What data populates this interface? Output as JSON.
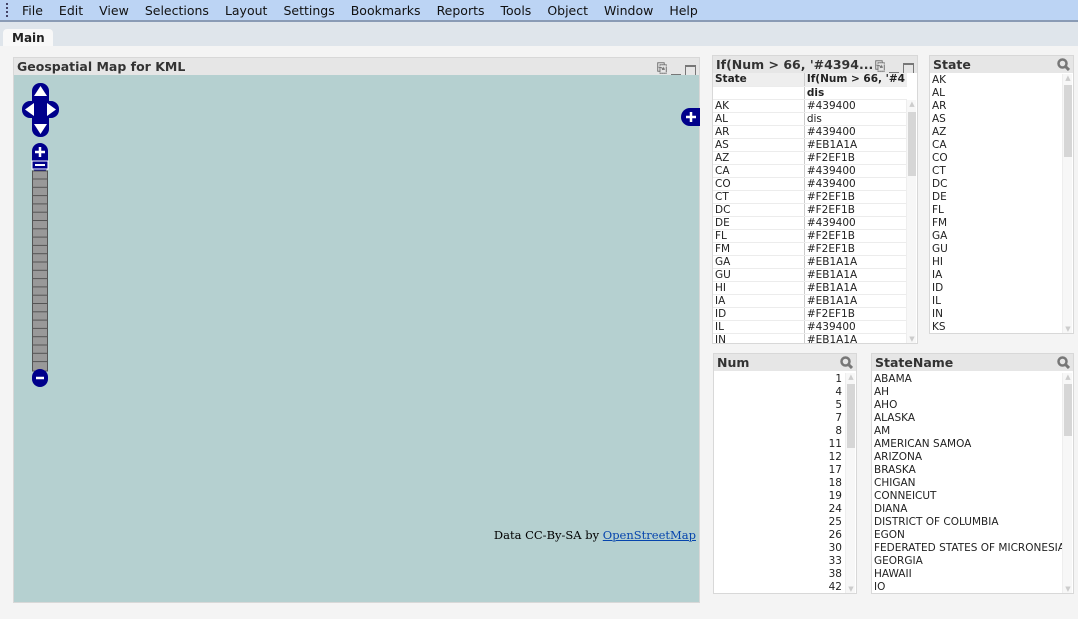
{
  "menu": [
    "File",
    "Edit",
    "View",
    "Selections",
    "Layout",
    "Settings",
    "Bookmarks",
    "Reports",
    "Tools",
    "Object",
    "Window",
    "Help"
  ],
  "tabs": [
    {
      "label": "Main",
      "active": true
    }
  ],
  "map": {
    "title": "Geospatial Map for KML",
    "attribution_prefix": "Data CC-By-SA by ",
    "attribution_link": "OpenStreetMap",
    "background": "#b5d0d0",
    "control_color": "#00008b"
  },
  "table": {
    "title": "If(Num > 66, '#4394...",
    "columns": [
      "State",
      "If(Num > 66, '#4"
    ],
    "total_row": [
      "",
      "dis"
    ],
    "rows": [
      [
        "AK",
        "#439400"
      ],
      [
        "AL",
        "dis"
      ],
      [
        "AR",
        "#439400"
      ],
      [
        "AS",
        "#EB1A1A"
      ],
      [
        "AZ",
        "#F2EF1B"
      ],
      [
        "CA",
        "#439400"
      ],
      [
        "CO",
        "#439400"
      ],
      [
        "CT",
        "#F2EF1B"
      ],
      [
        "DC",
        "#F2EF1B"
      ],
      [
        "DE",
        "#439400"
      ],
      [
        "FL",
        "#F2EF1B"
      ],
      [
        "FM",
        "#F2EF1B"
      ],
      [
        "GA",
        "#EB1A1A"
      ],
      [
        "GU",
        "#EB1A1A"
      ],
      [
        "HI",
        "#EB1A1A"
      ],
      [
        "IA",
        "#EB1A1A"
      ],
      [
        "ID",
        "#F2EF1B"
      ],
      [
        "IL",
        "#439400"
      ],
      [
        "IN",
        "#EB1A1A"
      ]
    ]
  },
  "state_list": {
    "title": "State",
    "items": [
      "AK",
      "AL",
      "AR",
      "AS",
      "AZ",
      "CA",
      "CO",
      "CT",
      "DC",
      "DE",
      "FL",
      "FM",
      "GA",
      "GU",
      "HI",
      "IA",
      "ID",
      "IL",
      "IN",
      "KS"
    ]
  },
  "num_list": {
    "title": "Num",
    "items": [
      "1",
      "4",
      "5",
      "7",
      "8",
      "11",
      "12",
      "17",
      "18",
      "19",
      "24",
      "25",
      "26",
      "30",
      "33",
      "38",
      "42"
    ]
  },
  "statename_list": {
    "title": "StateName",
    "items": [
      "ABAMA",
      "AH",
      "AHO",
      "ALASKA",
      "AM",
      "AMERICAN SAMOA",
      "ARIZONA",
      "BRASKA",
      "CHIGAN",
      "CONNEICUT",
      "DIANA",
      "DISTRICT OF COLUMBIA",
      "EGON",
      "FEDERATED STATES OF MICRONESIA",
      "GEORGIA",
      "HAWAII",
      "IO"
    ]
  }
}
